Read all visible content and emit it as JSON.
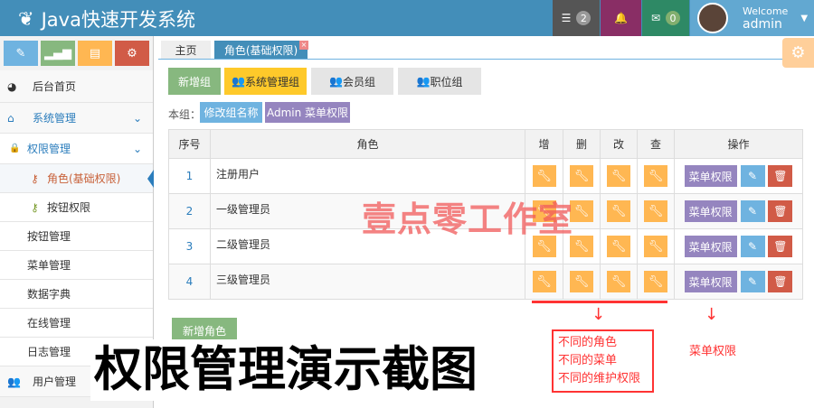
{
  "header": {
    "title": "Java快速开发系统",
    "tasks_count": "2",
    "messages_count": "0",
    "welcome": "Welcome",
    "user": "admin"
  },
  "shortcuts": [
    "pencil-icon",
    "signal-icon",
    "book-icon",
    "cogs-icon"
  ],
  "sidebar": {
    "items": [
      {
        "label": "后台首页"
      },
      {
        "label": "系统管理"
      },
      {
        "label": "权限管理"
      },
      {
        "label": "角色(基础权限)"
      },
      {
        "label": "按钮权限"
      },
      {
        "label": "按钮管理"
      },
      {
        "label": "菜单管理"
      },
      {
        "label": "数据字典"
      },
      {
        "label": "在线管理"
      },
      {
        "label": "日志管理"
      },
      {
        "label": "用户管理"
      }
    ]
  },
  "tabs": [
    {
      "label": "主页"
    },
    {
      "label": "角色(基础权限)"
    }
  ],
  "groups": {
    "add": "新增组",
    "items": [
      "系统管理组",
      "会员组",
      "职位组"
    ]
  },
  "current_group": {
    "label": "本组：",
    "rename": "修改组名称",
    "menu_perm": "Admin 菜单权限"
  },
  "table": {
    "headers": [
      "序号",
      "角色",
      "增",
      "删",
      "改",
      "查",
      "操作"
    ],
    "rows": [
      {
        "no": "1",
        "role": "注册用户"
      },
      {
        "no": "2",
        "role": "一级管理员"
      },
      {
        "no": "3",
        "role": "二级管理员"
      },
      {
        "no": "4",
        "role": "三级管理员"
      }
    ],
    "menu_btn": "菜单权限"
  },
  "add_role": "新增角色",
  "overlay": {
    "caption": "权限管理演示截图",
    "watermark": "壹点零工作室",
    "notes": [
      "不同的角色",
      "不同的菜单",
      "不同的维护权限"
    ],
    "menu_note": "菜单权限"
  }
}
